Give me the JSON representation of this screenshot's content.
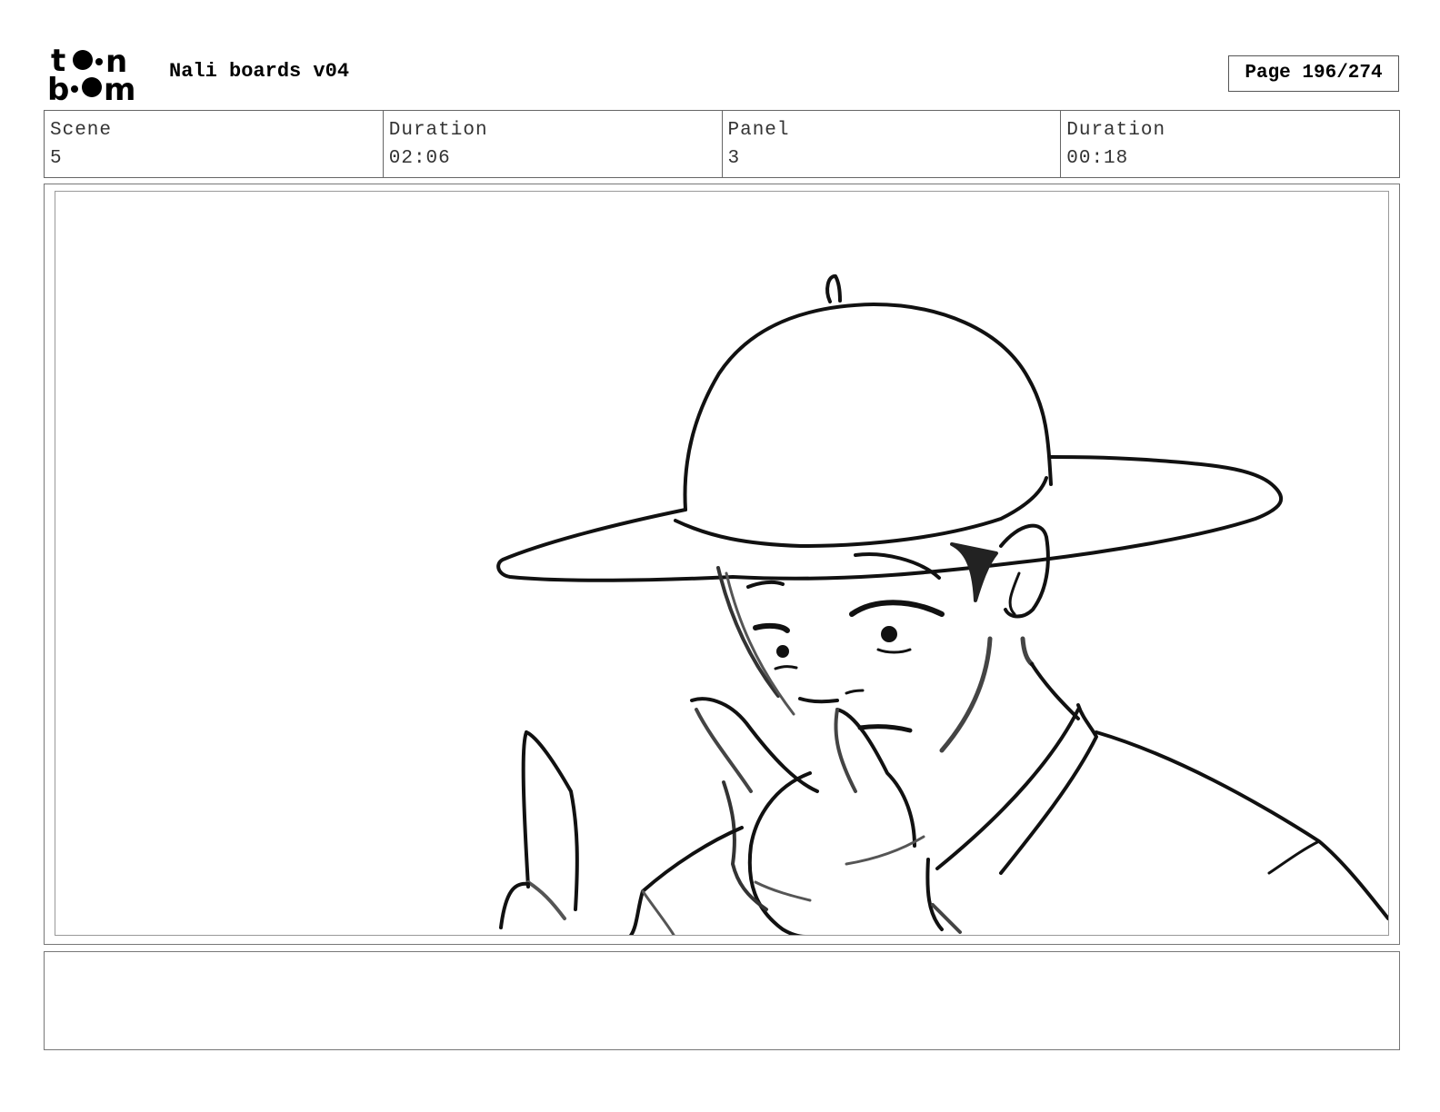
{
  "header": {
    "logo_text": "toon boom",
    "project_title": "Nali boards v04",
    "page_label": "Page 196/274"
  },
  "info": [
    {
      "label": "Scene",
      "value": "5"
    },
    {
      "label": "Duration",
      "value": "02:06"
    },
    {
      "label": "Panel",
      "value": "3"
    },
    {
      "label": "Duration",
      "value": "00:18"
    }
  ],
  "panel": {
    "sketch_subject": "boy-in-wide-brim-hat"
  },
  "notes": {
    "text": ""
  }
}
